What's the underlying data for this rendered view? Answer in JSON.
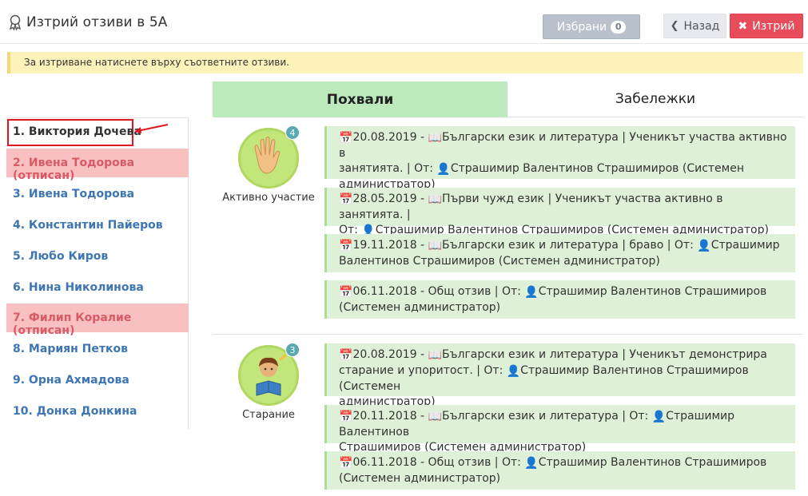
{
  "header": {
    "title": "Изтрий отзиви в 5А",
    "favorites_label": "Избрани",
    "favorites_count": "0",
    "back_label": "Назад",
    "delete_label": "Изтрий"
  },
  "alert": "За изтриване натиснете върху съответните отзиви.",
  "tabs": {
    "praise": "Похвали",
    "notes": "Забележки"
  },
  "students": [
    {
      "label": "1. Виктория Дочева",
      "status": "selected"
    },
    {
      "label": "2. Ивена Тодорова (отписан)",
      "status": "removed"
    },
    {
      "label": "3. Ивена Тодорова",
      "status": "normal"
    },
    {
      "label": "4. Константин Пайеров",
      "status": "normal"
    },
    {
      "label": "5. Любо Киров",
      "status": "normal"
    },
    {
      "label": "6. Нина Николинова",
      "status": "normal"
    },
    {
      "label": "7. Филип Коралие (отписан)",
      "status": "removed"
    },
    {
      "label": "8. Мариян Петков",
      "status": "normal"
    },
    {
      "label": "9. Орна Ахмадова",
      "status": "normal"
    },
    {
      "label": "10. Донка Донкина",
      "status": "normal"
    }
  ],
  "categories": [
    {
      "name": "Активно участие",
      "count": "4",
      "icon": "raised-hand-icon",
      "entries": [
        {
          "line1": "20.08.2019 - ",
          "subject": "Български език и литература | Ученикът участва активно в",
          "line2": "занятията. | От: ",
          "author": "Страшимир Валентинов Страшимиров (Системен",
          "line3": "администратор)"
        },
        {
          "line1": "28.05.2019 - ",
          "subject": "Първи чужд език | Ученикът участва активно в занятията. |",
          "line2": "От: ",
          "author": "Страшимир Валентинов Страшимиров (Системен администратор)",
          "line3": ""
        },
        {
          "line1": "19.11.2018 - ",
          "subject": "Български език и литература | браво | От: ",
          "line2": "",
          "author": "Страшимир",
          "line3": "Валентинов Страшимиров (Системен администратор)"
        },
        {
          "line1": "06.11.2018 - Общ отзив | От: ",
          "subject": "",
          "line2": "",
          "author": "Страшимир Валентинов Страшимиров",
          "line3": "(Системен администратор)"
        }
      ]
    },
    {
      "name": "Старание",
      "count": "3",
      "icon": "reading-student-icon",
      "entries": [
        {
          "line1": "20.08.2019 - ",
          "subject": "Български език и литература | Ученикът демонстрира",
          "line2": "старание и упоритост. | От: ",
          "author": "Страшимир Валентинов Страшимиров (Системен",
          "line3": "администратор)"
        },
        {
          "line1": "20.11.2018 - ",
          "subject": "Български език и литература | От: ",
          "line2": "",
          "author": "Страшимир Валентинов",
          "line3": "Страшимиров (Системен администратор)"
        },
        {
          "line1": "06.11.2018 - Общ отзив | От: ",
          "subject": "",
          "line2": "",
          "author": "Страшимир Валентинов Страшимиров",
          "line3": "(Системен администратор)"
        }
      ]
    }
  ],
  "colors": {
    "accent_green": "#bdeabd",
    "entry_bg": "#dff0d8",
    "removed_bg": "#f8c0c0",
    "danger": "#e74c5a",
    "link_blue": "#3d76b2"
  }
}
